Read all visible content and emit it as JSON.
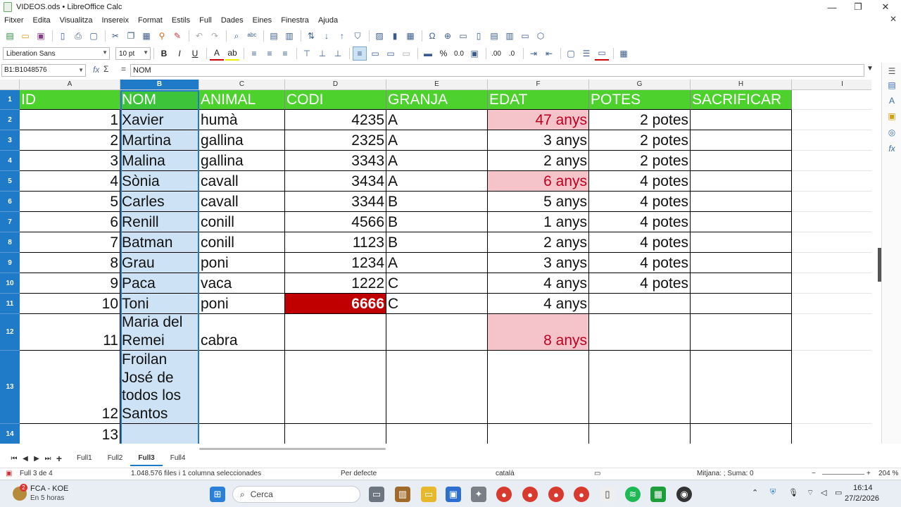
{
  "window": {
    "title": "VIDEOS.ods • LibreOffice Calc",
    "minimize": "—",
    "maximize": "❐",
    "close": "✕"
  },
  "menu": [
    "Fitxer",
    "Edita",
    "Visualitza",
    "Insereix",
    "Format",
    "Estils",
    "Full",
    "Dades",
    "Eines",
    "Finestra",
    "Ajuda"
  ],
  "formatting": {
    "font_name": "Liberation Sans",
    "font_size": "10 pt",
    "bold": "B",
    "italic": "I",
    "underline": "U",
    "percent": "%",
    "decimals": "0.0"
  },
  "formula_bar": {
    "name_box": "B1:B1048576",
    "fx": "fx",
    "sigma": "Σ",
    "equals": "=",
    "content": "NOM"
  },
  "columns": [
    "A",
    "B",
    "C",
    "D",
    "E",
    "F",
    "G",
    "H",
    "I"
  ],
  "selected_column": "B",
  "rows": [
    "1",
    "2",
    "3",
    "4",
    "5",
    "6",
    "7",
    "8",
    "9",
    "10",
    "11",
    "12",
    "13",
    "14"
  ],
  "headers": [
    "ID",
    "NOM",
    "ANIMAL",
    "CODI",
    "GRANJA",
    "EDAT",
    "POTES",
    "SACRIFICAR"
  ],
  "data": [
    {
      "id": "1",
      "nom": "Xavier",
      "animal": "humà",
      "codi": "4235",
      "granja": "A",
      "edat": "47 anys",
      "potes": "2 potes"
    },
    {
      "id": "2",
      "nom": "Martina",
      "animal": "gallina",
      "codi": "2325",
      "granja": "A",
      "edat": "3 anys",
      "potes": "2 potes"
    },
    {
      "id": "3",
      "nom": "Malina",
      "animal": "gallina",
      "codi": "3343",
      "granja": "A",
      "edat": "2 anys",
      "potes": "2 potes"
    },
    {
      "id": "4",
      "nom": "Sònia",
      "animal": "cavall",
      "codi": "3434",
      "granja": "A",
      "edat": "6 anys",
      "potes": "4 potes"
    },
    {
      "id": "5",
      "nom": "Carles",
      "animal": "cavall",
      "codi": "3344",
      "granja": "B",
      "edat": "5 anys",
      "potes": "4 potes"
    },
    {
      "id": "6",
      "nom": "Renill",
      "animal": "conill",
      "codi": "4566",
      "granja": "B",
      "edat": "1 anys",
      "potes": "4 potes"
    },
    {
      "id": "7",
      "nom": "Batman",
      "animal": "conill",
      "codi": "1123",
      "granja": "B",
      "edat": "2 anys",
      "potes": "4 potes"
    },
    {
      "id": "8",
      "nom": "Grau",
      "animal": "poni",
      "codi": "1234",
      "granja": "A",
      "edat": "3 anys",
      "potes": "4 potes"
    },
    {
      "id": "9",
      "nom": "Paca",
      "animal": "vaca",
      "codi": "1222",
      "granja": "C",
      "edat": "4 anys",
      "potes": "4 potes"
    },
    {
      "id": "10",
      "nom": "Toni",
      "animal": "poni",
      "codi": "6666",
      "granja": "C",
      "edat": "4 anys",
      "potes": ""
    },
    {
      "id": "11",
      "nom": "Maria del Remei",
      "animal": "cabra",
      "codi": "",
      "granja": "",
      "edat": "8 anys",
      "potes": ""
    },
    {
      "id": "12",
      "nom": "Froilan José de todos los Santos",
      "animal": "",
      "codi": "",
      "granja": "",
      "edat": "",
      "potes": ""
    },
    {
      "id": "13",
      "nom": "",
      "animal": "",
      "codi": "",
      "granja": "",
      "edat": "",
      "potes": ""
    }
  ],
  "highlights": {
    "edat_pink_rows": [
      1,
      4,
      11
    ],
    "codi_red_rows": [
      10
    ]
  },
  "colors": {
    "header_green": "#4dd22d",
    "selection_blue": "#1f7ac8",
    "selected_fill": "#cde3f5",
    "pink_fill": "#f5c4cb",
    "pink_text": "#c00020",
    "dark_red": "#c00000"
  },
  "sheet_tabs": [
    "Full1",
    "Full2",
    "Full3",
    "Full4"
  ],
  "active_tab": "Full3",
  "status": {
    "sheet": "Full 3 de 4",
    "selection": "1.048.576 files i 1 columna seleccionades",
    "style": "Per defecte",
    "language": "català",
    "sum": "Mitjana: ; Suma: 0",
    "zoom": "204 %"
  },
  "taskbar": {
    "weather_title": "FCA - KOE",
    "weather_sub": "En 5 horas",
    "badge": "2",
    "search_placeholder": "Cerca",
    "time": "16:14",
    "date": "27/2/2026"
  }
}
